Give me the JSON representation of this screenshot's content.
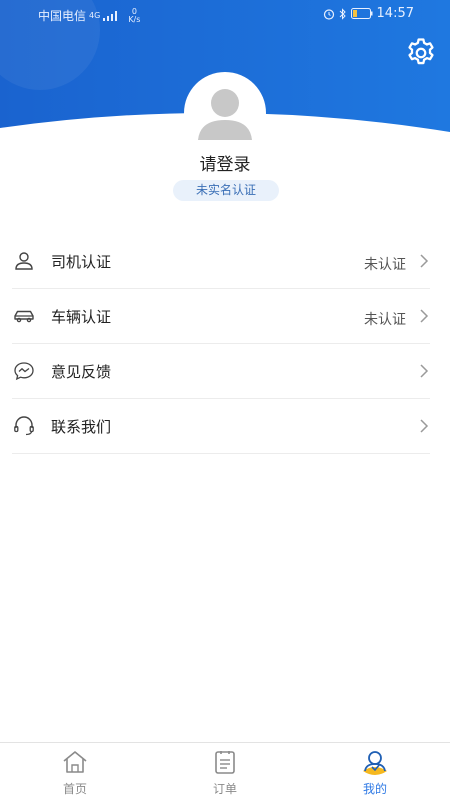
{
  "status_bar": {
    "carrier": "中国电信",
    "network": "4G",
    "speed_value": "0",
    "speed_unit": "K/s",
    "time": "14:57"
  },
  "profile": {
    "login_text": "请登录",
    "verify_badge": "未实名认证"
  },
  "menu": {
    "items": [
      {
        "label": "司机认证",
        "status": "未认证",
        "icon": "driver-icon"
      },
      {
        "label": "车辆认证",
        "status": "未认证",
        "icon": "car-icon"
      },
      {
        "label": "意见反馈",
        "status": "",
        "icon": "feedback-icon"
      },
      {
        "label": "联系我们",
        "status": "",
        "icon": "headset-icon"
      }
    ]
  },
  "tabbar": {
    "tabs": [
      {
        "label": "首页",
        "icon": "home-icon",
        "active": false
      },
      {
        "label": "订单",
        "icon": "order-icon",
        "active": false
      },
      {
        "label": "我的",
        "icon": "profile-icon",
        "active": true
      }
    ]
  },
  "colors": {
    "header_blue": "#1e6fd9",
    "accent": "#2f7ae5",
    "badge_bg": "#e9f1fb",
    "badge_text": "#3a6fb6"
  }
}
